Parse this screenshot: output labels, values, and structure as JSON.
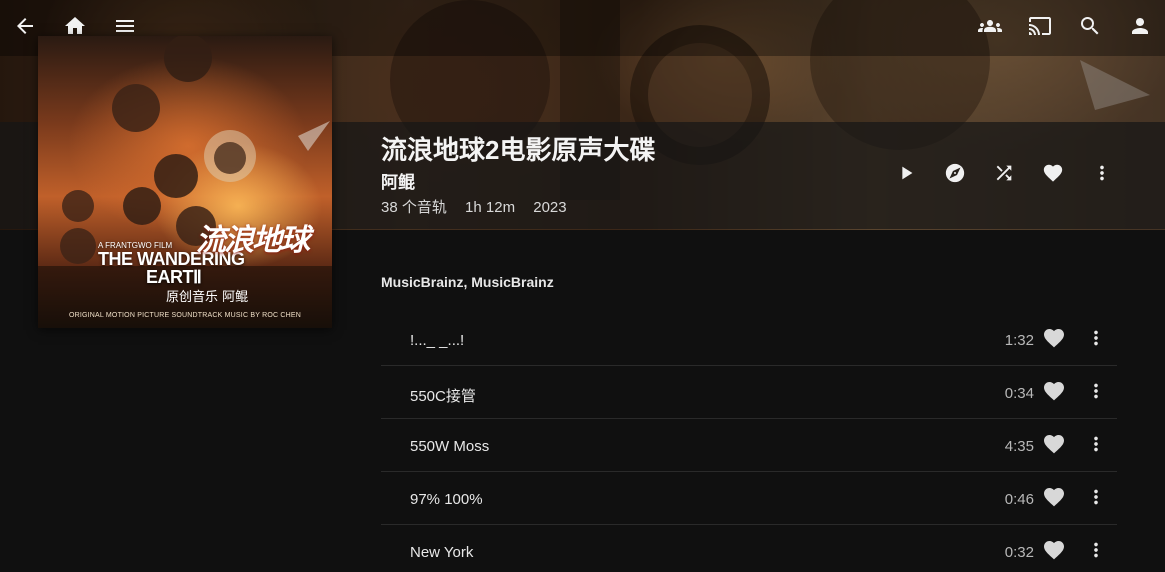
{
  "header": {
    "icons": [
      "back-arrow-icon",
      "home-icon",
      "menu-icon",
      "users-icon",
      "cast-icon",
      "search-icon",
      "user-icon"
    ]
  },
  "album": {
    "title": "流浪地球2电影原声大碟",
    "artist": "阿鲲",
    "track_count": "38 个音轨",
    "duration": "1h 12m",
    "year": "2023",
    "cover": {
      "brand_small": "A FRANTGWO FILM",
      "brand_line1": "THE WANDERING",
      "brand_line2": "EARTⅡ",
      "cn_title": "流浪地球",
      "composer": "原创音乐 阿鲲",
      "credits": "ORIGINAL MOTION PICTURE SOUNDTRACK   MUSIC BY ROC CHEN"
    }
  },
  "actions": [
    "play-icon",
    "instant-mix-icon",
    "shuffle-icon",
    "favorite-icon",
    "more-icon"
  ],
  "section_label": "MusicBrainz, MusicBrainz",
  "tracks": [
    {
      "name": "!..._ _...!",
      "duration": "1:32"
    },
    {
      "name": "550C接管",
      "duration": "0:34"
    },
    {
      "name": "550W Moss",
      "duration": "4:35"
    },
    {
      "name": "97% 100%",
      "duration": "0:46"
    },
    {
      "name": "New York",
      "duration": "0:32"
    }
  ]
}
